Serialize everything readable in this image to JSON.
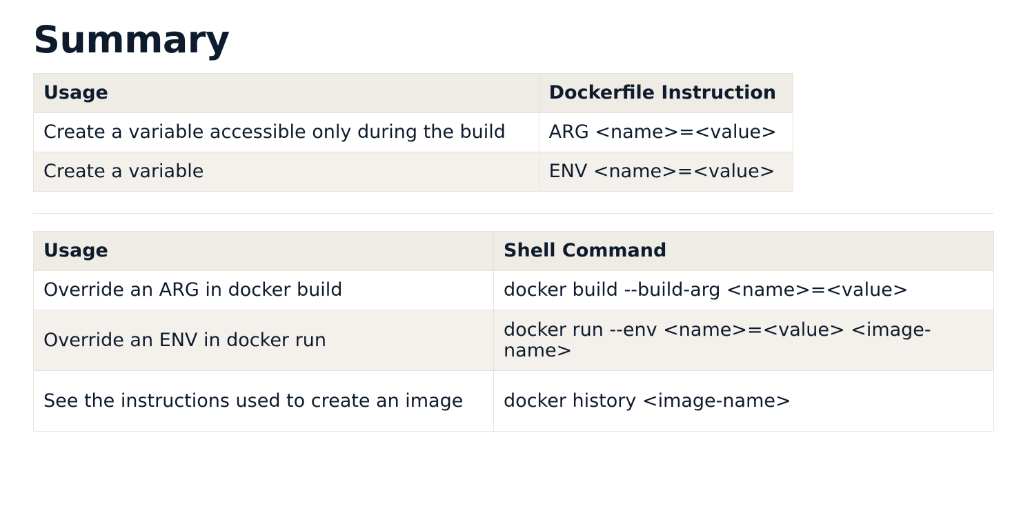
{
  "title": "Summary",
  "instructions_table": {
    "headers": [
      "Usage",
      "Dockerfile Instruction"
    ],
    "rows": [
      [
        "Create a variable accessible only during the build",
        "ARG <name>=<value>"
      ],
      [
        "Create a variable",
        "ENV <name>=<value>"
      ]
    ]
  },
  "commands_table": {
    "headers": [
      "Usage",
      "Shell Command"
    ],
    "rows": [
      [
        "Override an ARG in docker build",
        "docker build --build-arg <name>=<value>"
      ],
      [
        "Override an ENV in docker run",
        "docker run --env <name>=<value> <image-name>"
      ],
      [
        "See the instructions used to create an image",
        "docker history <image-name>"
      ]
    ]
  },
  "colors": {
    "text": "#0e1b2c",
    "header_bg": "#efebe5",
    "alt_row_bg": "#f4f1ec",
    "border": "#e5e2dc"
  }
}
